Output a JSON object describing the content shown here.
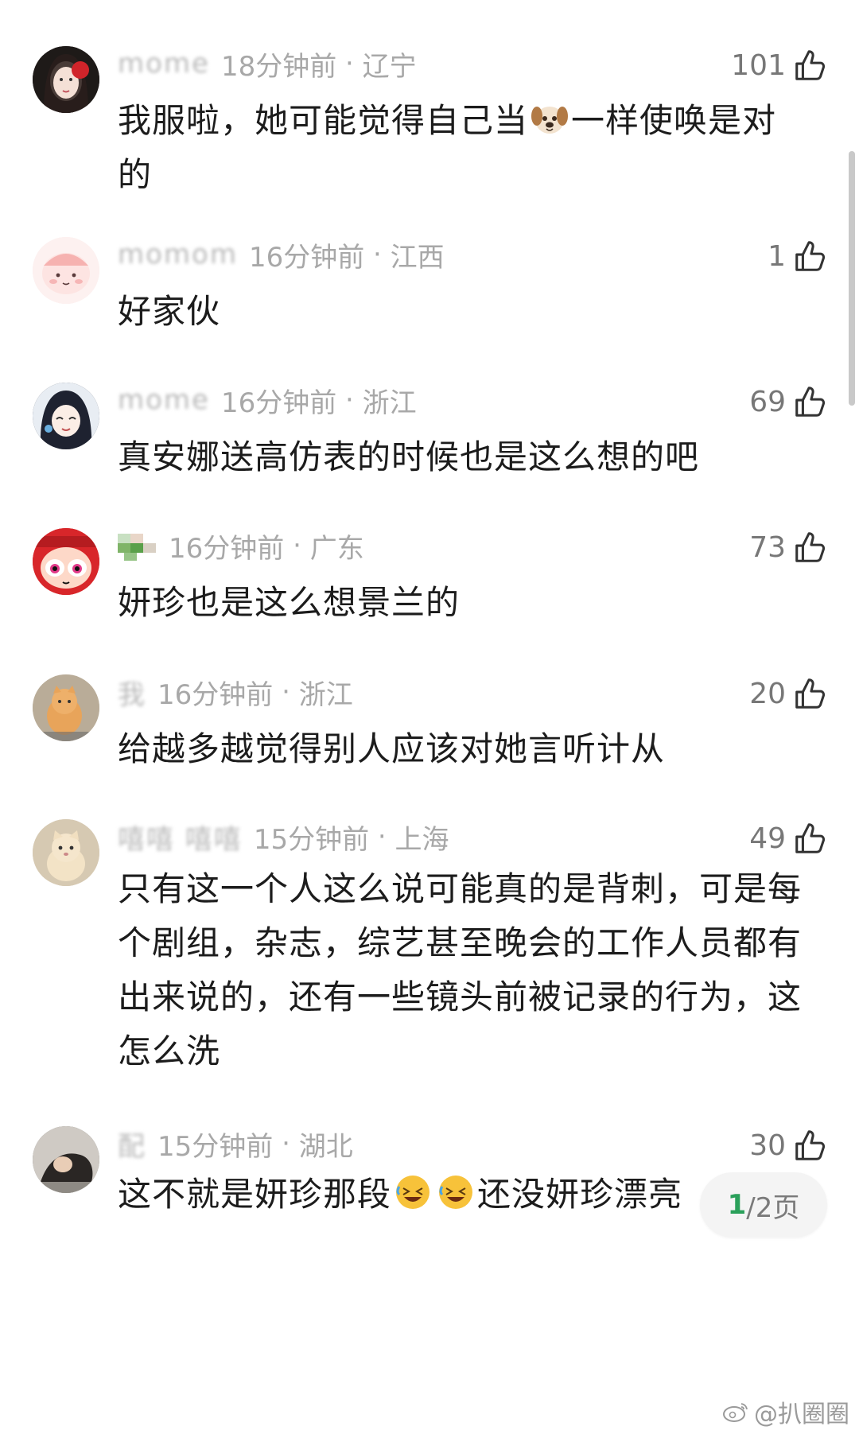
{
  "comments": [
    {
      "username": "mome",
      "time": "18分钟前",
      "region": "辽宁",
      "likes": "101",
      "text_before_emoji": "我服啦，她可能觉得自己当",
      "emoji": "dog-face-emoji",
      "text_after_emoji": "一样使唤是对的"
    },
    {
      "username": "momom",
      "time": "16分钟前",
      "region": "江西",
      "likes": "1",
      "text": "好家伙"
    },
    {
      "username": "mome",
      "time": "16分钟前",
      "region": "浙江",
      "likes": "69",
      "text": "真安娜送高仿表的时候也是这么想的吧"
    },
    {
      "username": "",
      "time": "16分钟前",
      "region": "广东",
      "likes": "73",
      "text": "妍珍也是这么想景兰的"
    },
    {
      "username": "我",
      "time": "16分钟前",
      "region": "浙江",
      "likes": "20",
      "text": "给越多越觉得别人应该对她言听计从"
    },
    {
      "username": "嘻嘻 嘻嘻",
      "time": "15分钟前",
      "region": "上海",
      "likes": "49",
      "text": "只有这一个人这么说可能真的是背刺，可是每个剧组，杂志，综艺甚至晚会的工作人员都有出来说的，还有一些镜头前被记录的行为，这怎么洗"
    },
    {
      "username": "配",
      "time": "15分钟前",
      "region": "湖北",
      "likes": "30",
      "text_before_emoji": "这不就是妍珍那段",
      "emoji": "rolling-laughing-emoji",
      "text_after_emoji": "还没妍珍漂亮"
    }
  ],
  "pager": {
    "current": "1",
    "total": "/2页"
  },
  "watermark": {
    "text": "@扒圈圈",
    "icon": "weibo-icon"
  },
  "colors": {
    "accent": "#2aa05a",
    "meta": "#a8a8a8",
    "text": "#1c1c1c"
  }
}
